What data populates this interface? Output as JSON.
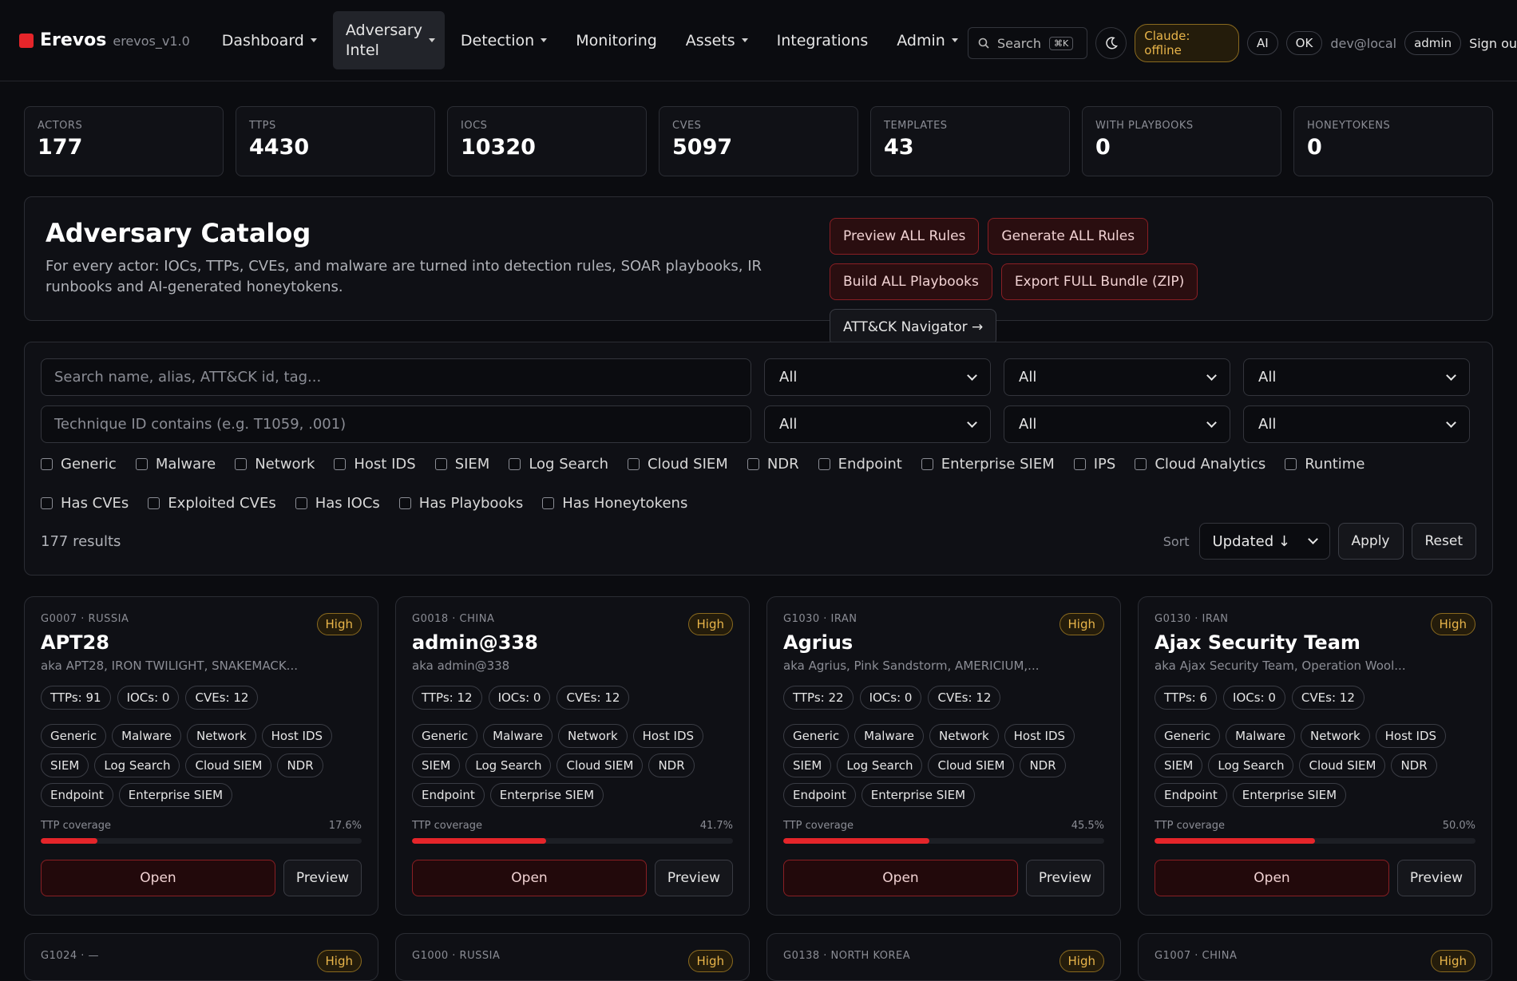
{
  "app": {
    "name": "Erevos",
    "version": "erevos_v1.0"
  },
  "nav": [
    {
      "label": "Dashboard",
      "dropdown": true
    },
    {
      "label": "Adversary Intel",
      "dropdown": true,
      "active": true
    },
    {
      "label": "Detection",
      "dropdown": true
    },
    {
      "label": "Monitoring",
      "dropdown": false
    },
    {
      "label": "Assets",
      "dropdown": true
    },
    {
      "label": "Integrations",
      "dropdown": false
    },
    {
      "label": "Admin",
      "dropdown": true
    }
  ],
  "toolbar": {
    "search_label": "Search",
    "search_shortcut": "⌘K",
    "claude_status": "Claude: offline",
    "ai_label": "AI",
    "ok_label": "OK",
    "user": "dev@local",
    "role": "admin",
    "signout": "Sign ou"
  },
  "stats": [
    {
      "label": "ACTORS",
      "value": "177"
    },
    {
      "label": "TTPS",
      "value": "4430"
    },
    {
      "label": "IOCS",
      "value": "10320"
    },
    {
      "label": "CVES",
      "value": "5097"
    },
    {
      "label": "TEMPLATES",
      "value": "43"
    },
    {
      "label": "WITH PLAYBOOKS",
      "value": "0"
    },
    {
      "label": "HONEYTOKENS",
      "value": "0"
    }
  ],
  "catalog": {
    "title": "Adversary Catalog",
    "description": "For every actor: IOCs, TTPs, CVEs, and malware are turned into detection rules, SOAR playbooks, IR runbooks and AI-generated honeytokens.",
    "actions": {
      "preview_all": "Preview ALL Rules",
      "generate_all": "Generate ALL Rules",
      "build_playbooks": "Build ALL Playbooks",
      "export_bundle": "Export FULL Bundle (ZIP)",
      "navigator": "ATT&CK Navigator →"
    }
  },
  "filters": {
    "search_placeholder": "Search name, alias, ATT&CK id, tag...",
    "technique_placeholder": "Technique ID contains (e.g. T1059, .001)",
    "selects": [
      "All",
      "All",
      "All",
      "All",
      "All",
      "All"
    ],
    "checkboxes": [
      "Generic",
      "Malware",
      "Network",
      "Host IDS",
      "SIEM",
      "Log Search",
      "Cloud SIEM",
      "NDR",
      "Endpoint",
      "Enterprise SIEM",
      "IPS",
      "Cloud Analytics",
      "Runtime",
      "Has CVEs",
      "Exploited CVEs",
      "Has IOCs",
      "Has Playbooks",
      "Has Honeytokens"
    ],
    "result_count": "177 results",
    "sort_label": "Sort",
    "sort_value": "Updated ↓",
    "apply": "Apply",
    "reset": "Reset"
  },
  "cards": [
    {
      "meta": "G0007 · RUSSIA",
      "severity": "High",
      "name": "APT28",
      "aka": "aka APT28, IRON TWILIGHT, SNAKEMACK...",
      "ttps": "TTPs: 91",
      "iocs": "IOCs: 0",
      "cves": "CVEs: 12",
      "tags": [
        "Generic",
        "Malware",
        "Network",
        "Host IDS",
        "SIEM",
        "Log Search",
        "Cloud SIEM",
        "NDR",
        "Endpoint",
        "Enterprise SIEM"
      ],
      "coverage_label": "TTP coverage",
      "coverage_text": "17.6%",
      "coverage": 17.6,
      "open": "Open",
      "preview": "Preview"
    },
    {
      "meta": "G0018 · CHINA",
      "severity": "High",
      "name": "admin@338",
      "aka": "aka admin@338",
      "ttps": "TTPs: 12",
      "iocs": "IOCs: 0",
      "cves": "CVEs: 12",
      "tags": [
        "Generic",
        "Malware",
        "Network",
        "Host IDS",
        "SIEM",
        "Log Search",
        "Cloud SIEM",
        "NDR",
        "Endpoint",
        "Enterprise SIEM"
      ],
      "coverage_label": "TTP coverage",
      "coverage_text": "41.7%",
      "coverage": 41.7,
      "open": "Open",
      "preview": "Preview"
    },
    {
      "meta": "G1030 · IRAN",
      "severity": "High",
      "name": "Agrius",
      "aka": "aka Agrius, Pink Sandstorm, AMERICIUM,...",
      "ttps": "TTPs: 22",
      "iocs": "IOCs: 0",
      "cves": "CVEs: 12",
      "tags": [
        "Generic",
        "Malware",
        "Network",
        "Host IDS",
        "SIEM",
        "Log Search",
        "Cloud SIEM",
        "NDR",
        "Endpoint",
        "Enterprise SIEM"
      ],
      "coverage_label": "TTP coverage",
      "coverage_text": "45.5%",
      "coverage": 45.5,
      "open": "Open",
      "preview": "Preview"
    },
    {
      "meta": "G0130 · IRAN",
      "severity": "High",
      "name": "Ajax Security Team",
      "aka": "aka Ajax Security Team, Operation Wool...",
      "ttps": "TTPs: 6",
      "iocs": "IOCs: 0",
      "cves": "CVEs: 12",
      "tags": [
        "Generic",
        "Malware",
        "Network",
        "Host IDS",
        "SIEM",
        "Log Search",
        "Cloud SIEM",
        "NDR",
        "Endpoint",
        "Enterprise SIEM"
      ],
      "coverage_label": "TTP coverage",
      "coverage_text": "50.0%",
      "coverage": 50.0,
      "open": "Open",
      "preview": "Preview"
    }
  ],
  "cards_next": [
    {
      "meta": "G1024 · —",
      "severity": "High"
    },
    {
      "meta": "G1000 · RUSSIA",
      "severity": "High"
    },
    {
      "meta": "G0138 · NORTH KOREA",
      "severity": "High"
    },
    {
      "meta": "G1007 · CHINA",
      "severity": "High"
    }
  ]
}
